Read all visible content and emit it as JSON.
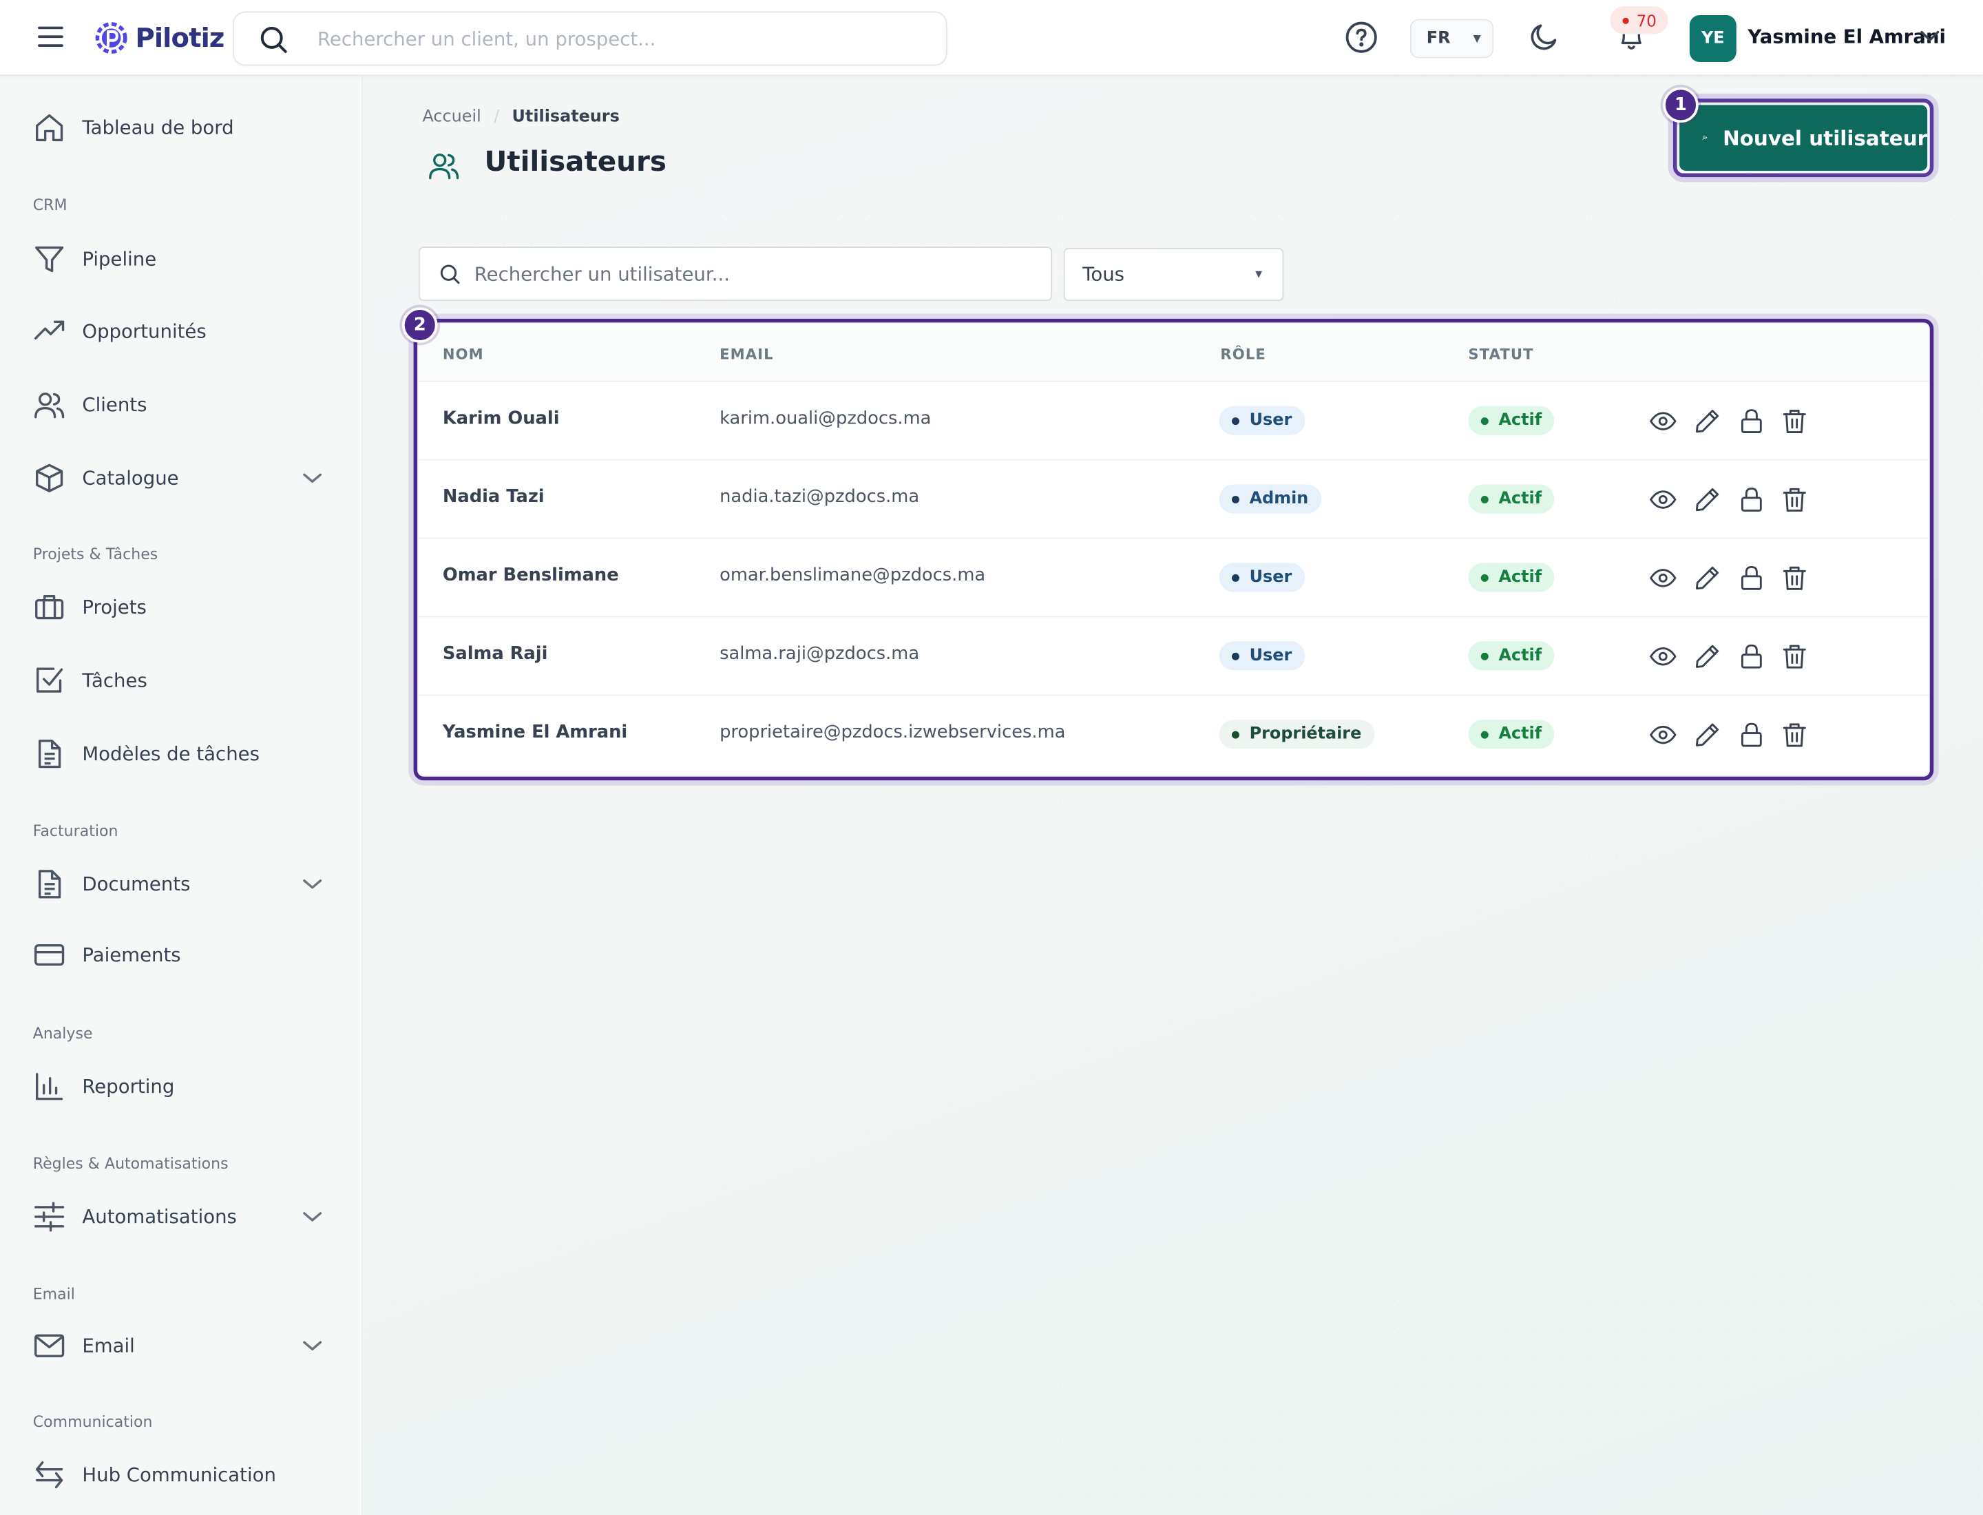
{
  "topbar": {
    "logo_text": "Pilotiz",
    "search_placeholder": "Rechercher un client, un prospect...",
    "language": "FR",
    "notifications_count": "70",
    "user_initials": "YE",
    "user_name": "Yasmine El Amrani"
  },
  "sidebar": {
    "items": [
      {
        "label": "Tableau de bord",
        "icon": "home-icon"
      },
      {
        "label": "Pipeline",
        "icon": "funnel-icon"
      },
      {
        "label": "Opportunités",
        "icon": "trending-up-icon"
      },
      {
        "label": "Clients",
        "icon": "users-icon"
      },
      {
        "label": "Catalogue",
        "icon": "box-icon"
      },
      {
        "label": "Projets",
        "icon": "briefcase-icon"
      },
      {
        "label": "Tâches",
        "icon": "checkbox-icon"
      },
      {
        "label": "Modèles de tâches",
        "icon": "document-icon"
      },
      {
        "label": "Documents",
        "icon": "document-icon"
      },
      {
        "label": "Paiements",
        "icon": "credit-card-icon"
      },
      {
        "label": "Reporting",
        "icon": "bar-chart-icon"
      },
      {
        "label": "Automatisations",
        "icon": "sliders-icon"
      },
      {
        "label": "Email",
        "icon": "mail-icon"
      },
      {
        "label": "Hub Communication",
        "icon": "arrows-icon"
      }
    ],
    "sections": {
      "crm": "CRM",
      "projects": "Projets & Tâches",
      "billing": "Facturation",
      "analysis": "Analyse",
      "rules": "Règles & Automatisations",
      "email": "Email",
      "communication": "Communication"
    }
  },
  "page": {
    "breadcrumb_home": "Accueil",
    "breadcrumb_current": "Utilisateurs",
    "title": "Utilisateurs",
    "new_user_label": "Nouvel utilisateur",
    "marker_1": "1",
    "marker_2": "2",
    "search_placeholder": "Rechercher un utilisateur...",
    "filter_value": "Tous"
  },
  "table": {
    "headers": {
      "name": "NOM",
      "email": "EMAIL",
      "role": "RÔLE",
      "status": "STATUT"
    },
    "rows": [
      {
        "name": "Karim Ouali",
        "email": "karim.ouali@pzdocs.ma",
        "role": "User",
        "status": "Actif"
      },
      {
        "name": "Nadia Tazi",
        "email": "nadia.tazi@pzdocs.ma",
        "role": "Admin",
        "status": "Actif"
      },
      {
        "name": "Omar Benslimane",
        "email": "omar.benslimane@pzdocs.ma",
        "role": "User",
        "status": "Actif"
      },
      {
        "name": "Salma Raji",
        "email": "salma.raji@pzdocs.ma",
        "role": "User",
        "status": "Actif"
      },
      {
        "name": "Yasmine El Amrani",
        "email": "proprietaire@pzdocs.izwebservices.ma",
        "role": "Propriétaire",
        "status": "Actif"
      }
    ]
  },
  "colors": {
    "accent": "#0f6a5e",
    "highlight": "#4c2a8c",
    "status_active": "#15803d",
    "notification": "#dc2626"
  }
}
